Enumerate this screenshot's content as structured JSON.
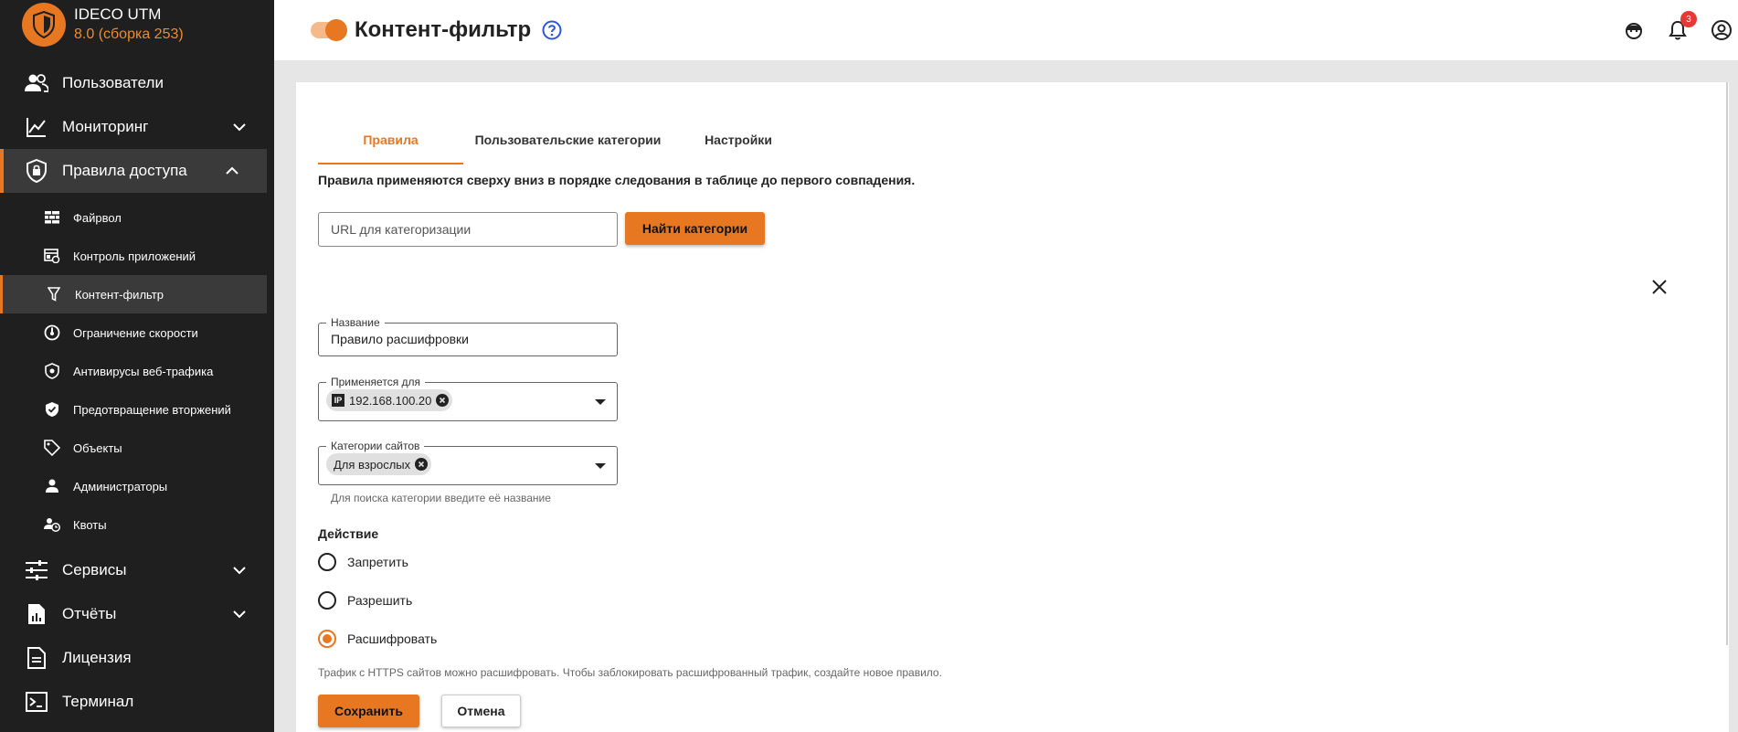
{
  "brand": {
    "name": "IDECO UTM",
    "version": "8.0 (сборка 253)"
  },
  "sidebar": {
    "top": [
      {
        "label": "Пользователи",
        "icon": "users-icon"
      },
      {
        "label": "Мониторинг",
        "icon": "monitoring-chart-icon",
        "expanded": false
      },
      {
        "label": "Правила доступа",
        "icon": "shield-lock-icon",
        "expanded": true
      }
    ],
    "sub": [
      {
        "label": "Файрвол",
        "icon": "firewall-icon"
      },
      {
        "label": "Контроль приложений",
        "icon": "app-control-icon"
      },
      {
        "label": "Контент-фильтр",
        "icon": "filter-icon",
        "active": true
      },
      {
        "label": "Ограничение скорости",
        "icon": "speed-limit-icon"
      },
      {
        "label": "Антивирусы веб-трафика",
        "icon": "antivirus-shield-icon"
      },
      {
        "label": "Предотвращение вторжений",
        "icon": "shield-check-icon"
      },
      {
        "label": "Объекты",
        "icon": "tag-icon"
      },
      {
        "label": "Администраторы",
        "icon": "admin-icon"
      },
      {
        "label": "Квоты",
        "icon": "quota-icon"
      }
    ],
    "bottom": [
      {
        "label": "Сервисы",
        "icon": "sliders-icon",
        "expanded": false
      },
      {
        "label": "Отчёты",
        "icon": "report-chart-icon",
        "expanded": false
      },
      {
        "label": "Лицензия",
        "icon": "license-document-icon"
      },
      {
        "label": "Терминал",
        "icon": "terminal-icon"
      }
    ]
  },
  "header": {
    "title": "Контент-фильтр",
    "toggle_on": true,
    "notifications_count": "3"
  },
  "tabs": [
    {
      "label": "Правила",
      "active": true
    },
    {
      "label": "Пользовательские категории",
      "active": false
    },
    {
      "label": "Настройки",
      "active": false
    }
  ],
  "info_text": "Правила применяются сверху вниз в порядке следования в таблице до первого совпадения.",
  "url_search": {
    "placeholder": "URL для категоризации",
    "value": "",
    "button": "Найти категории"
  },
  "form": {
    "name": {
      "label": "Название",
      "value": "Правило расшифровки"
    },
    "applies_to": {
      "label": "Применяется для",
      "chip_badge": "IP",
      "chip": "192.168.100.20"
    },
    "categories": {
      "label": "Категории сайтов",
      "chip": "Для взрослых",
      "hint": "Для поиска категории введите её название"
    },
    "action": {
      "title": "Действие",
      "options": [
        {
          "label": "Запретить",
          "checked": false
        },
        {
          "label": "Разрешить",
          "checked": false
        },
        {
          "label": "Расшифровать",
          "checked": true
        }
      ],
      "hint": "Трафик с HTTPS сайтов можно расшифровать. Чтобы заблокировать расшифрованный трафик, создайте новое правило."
    },
    "save": "Сохранить",
    "cancel": "Отмена"
  },
  "colors": {
    "accent": "#e87722",
    "sidebar_bg": "#1f1f1f",
    "sidebar_active": "#3a3a3a",
    "help": "#2f56d6",
    "badge": "#e53935"
  }
}
